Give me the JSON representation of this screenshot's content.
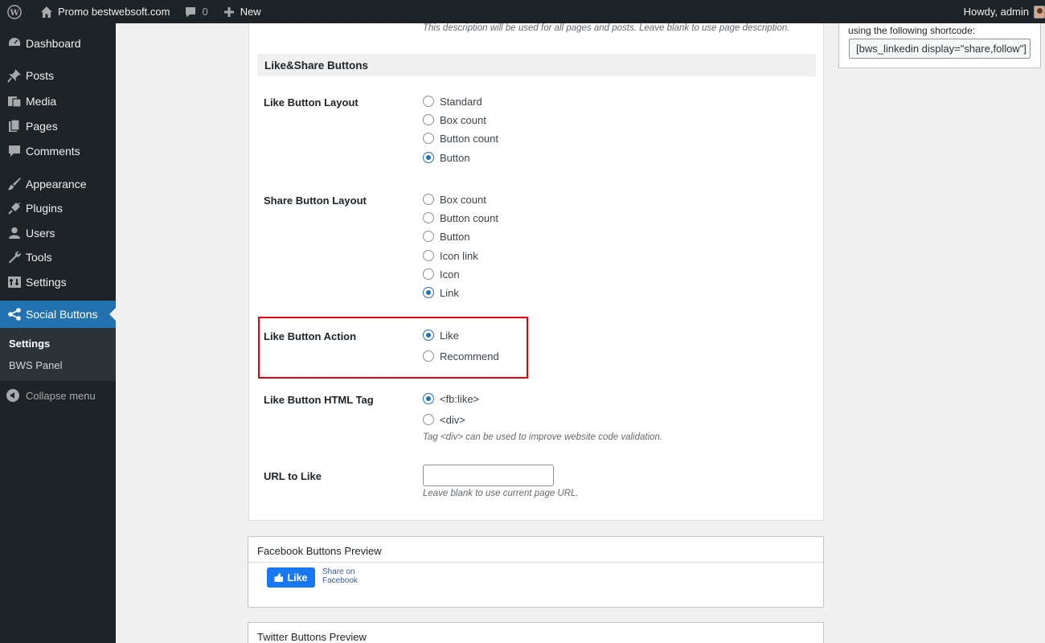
{
  "admin_bar": {
    "site_name": "Promo bestwebsoft.com",
    "comments_count": "0",
    "new_label": "New",
    "greeting": "Howdy, admin"
  },
  "sidebar": {
    "items": [
      {
        "label": "Dashboard",
        "icon": "dashboard-icon"
      },
      {
        "label": "Posts",
        "icon": "pin-icon"
      },
      {
        "label": "Media",
        "icon": "media-icon"
      },
      {
        "label": "Pages",
        "icon": "pages-icon"
      },
      {
        "label": "Comments",
        "icon": "comment-icon"
      },
      {
        "label": "Appearance",
        "icon": "brush-icon"
      },
      {
        "label": "Plugins",
        "icon": "plug-icon"
      },
      {
        "label": "Users",
        "icon": "user-icon"
      },
      {
        "label": "Tools",
        "icon": "wrench-icon"
      },
      {
        "label": "Settings",
        "icon": "settings-icon"
      },
      {
        "label": "Social Buttons",
        "icon": "share-icon"
      }
    ],
    "submenu": [
      {
        "label": "Settings"
      },
      {
        "label": "BWS Panel"
      }
    ],
    "collapse_label": "Collapse menu"
  },
  "panel": {
    "top_description": "This description will be used for all pages and posts. Leave blank to use page description.",
    "section_title": "Like&Share Buttons",
    "like_layout": {
      "label": "Like Button Layout",
      "options": [
        "Standard",
        "Box count",
        "Button count",
        "Button"
      ],
      "selected": "Button"
    },
    "share_layout": {
      "label": "Share Button Layout",
      "options": [
        "Box count",
        "Button count",
        "Button",
        "Icon link",
        "Icon",
        "Link"
      ],
      "selected": "Link"
    },
    "like_action": {
      "label": "Like Button Action",
      "options": [
        "Like",
        "Recommend"
      ],
      "selected": "Like"
    },
    "html_tag": {
      "label": "Like Button HTML Tag",
      "options": [
        "<fb:like>",
        "<div>"
      ],
      "selected": "<fb:like>",
      "description": "Tag <div> can be used to improve website code validation."
    },
    "url_to_like": {
      "label": "URL to Like",
      "value": "",
      "description": "Leave blank to use current page URL."
    }
  },
  "facebook_preview": {
    "title": "Facebook Buttons Preview",
    "like_label": "Like",
    "share_label": "Share on Facebook"
  },
  "twitter_preview": {
    "title": "Twitter Buttons Preview"
  },
  "shortcode_box": {
    "text": "using the following shortcode:",
    "code": "[bws_linkedin display=\"share,follow\"]"
  },
  "colors": {
    "admin_dark": "#1d2327",
    "accent_blue": "#2271b1",
    "facebook_blue": "#1877f2",
    "highlight_red": "#e0000f"
  }
}
